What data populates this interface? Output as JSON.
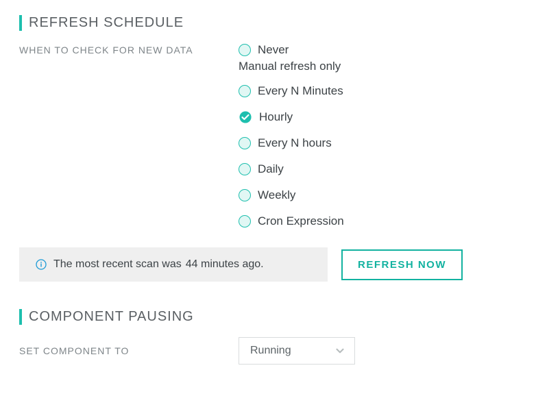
{
  "refresh": {
    "header": "REFRESH SCHEDULE",
    "label": "WHEN TO CHECK FOR NEW DATA",
    "options": {
      "never": "Never",
      "never_sub": "Manual refresh only",
      "every_n_minutes": "Every N Minutes",
      "hourly": "Hourly",
      "every_n_hours": "Every N hours",
      "daily": "Daily",
      "weekly": "Weekly",
      "cron": "Cron Expression"
    },
    "status_prefix": "The most recent scan was",
    "status_time": "44 minutes ago.",
    "refresh_now": "REFRESH NOW"
  },
  "pausing": {
    "header": "COMPONENT PAUSING",
    "label": "SET COMPONENT TO",
    "select_value": "Running"
  }
}
